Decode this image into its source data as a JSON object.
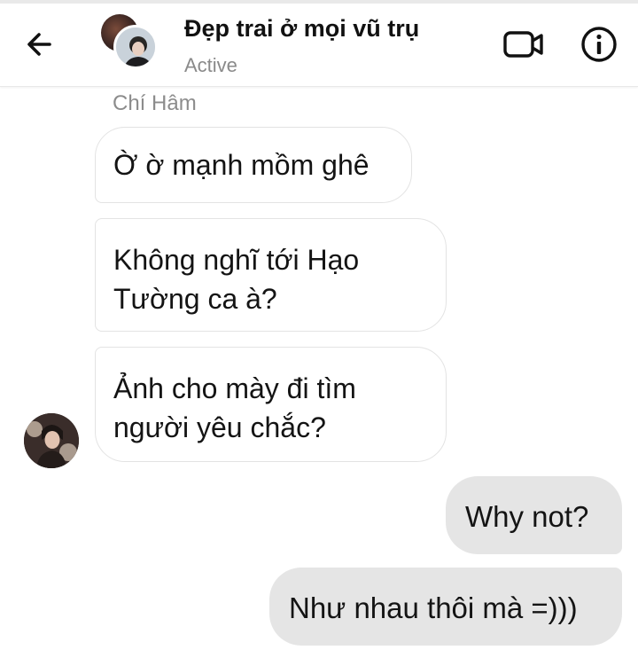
{
  "header": {
    "title": "Đẹp trai ở mọi vũ trụ",
    "status": "Active",
    "back_icon": "arrow-left-icon",
    "video_icon": "video-camera-icon",
    "info_icon": "info-icon"
  },
  "conversation": {
    "sender_name": "Chí Hâm",
    "incoming": [
      {
        "text_lines": [
          "Ờ ờ mạnh mồm ghê"
        ]
      },
      {
        "text_lines": [
          "Không nghĩ tới Hạo",
          "Tường ca à?"
        ]
      },
      {
        "text_lines": [
          "Ảnh cho mày đi tìm",
          "người yêu chắc?"
        ]
      }
    ],
    "outgoing": [
      {
        "text": "Why not?"
      },
      {
        "text": "Như nhau thôi mà =)))"
      }
    ]
  },
  "colors": {
    "incoming_bubble_border": "#e3e3e3",
    "outgoing_bubble_bg": "#e5e5e5",
    "status_text": "#8a8a8a"
  }
}
